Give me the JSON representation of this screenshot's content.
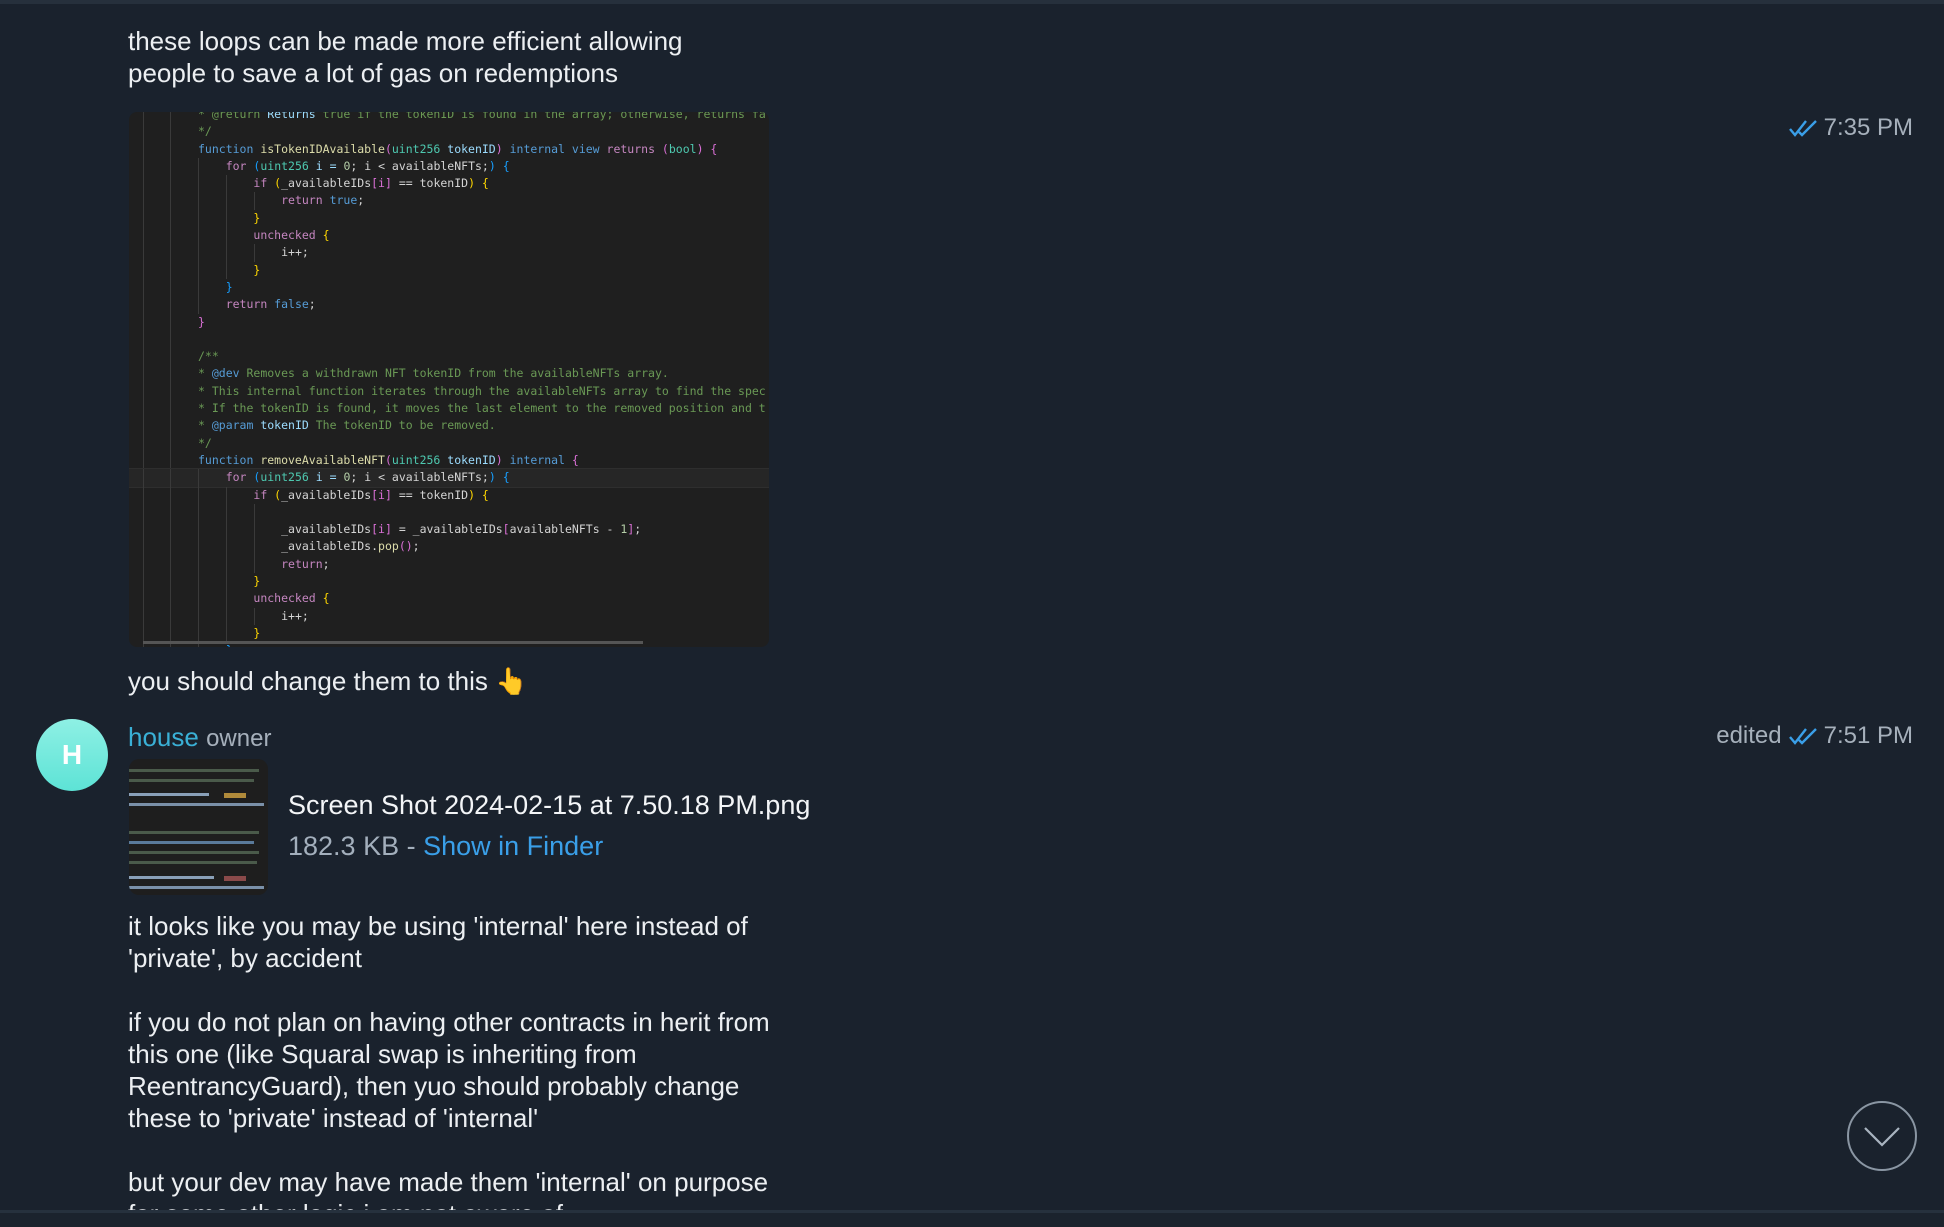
{
  "messages": {
    "msg1_lines": [
      "these loops can be made more efficient allowing",
      "people to save a lot of gas on redemptions"
    ],
    "msg1_time": "7:35 PM",
    "msg2_text": "you should change them to this 👆",
    "sender": {
      "initial": "H",
      "name": "house",
      "role": "owner"
    },
    "msg3_status": "edited",
    "msg3_time": "7:51 PM",
    "file": {
      "name": "Screen Shot 2024-02-15 at 7.50.18 PM.png",
      "size": "182.3 KB",
      "separator": " - ",
      "action": "Show in Finder"
    },
    "msg4_lines": [
      "it looks like you may be using 'internal' here instead of",
      "'private', by accident",
      "",
      "if you do not plan on having other contracts in herit from",
      "this one (like Squaral swap is inheriting from",
      "ReentrancyGuard), then yuo should probably change",
      "these to 'private' instead of 'internal'",
      "",
      "but your dev may have made them 'internal' on purpose",
      "for some other logic i am not aware of"
    ]
  },
  "colors": {
    "accent": "#3a9fe8",
    "sender": "#3ab0d6",
    "avatar": "#6ce8db",
    "background": "#1a222d"
  },
  "icons": {
    "read_check": "double-check-icon",
    "scroll_down": "chevron-down-icon"
  },
  "code_lines": [
    {
      "i": 0,
      "s": [
        [
          "* @return ",
          "cm"
        ],
        [
          "Returns ",
          "va"
        ],
        [
          "true if the tokenID is found in the array; otherwise, returns fa",
          "cm"
        ]
      ]
    },
    {
      "i": 0,
      "s": [
        [
          "*/",
          "cm"
        ]
      ]
    },
    {
      "i": 0,
      "s": [
        [
          "function ",
          "bl"
        ],
        [
          "isTokenIDAvailable",
          "fn"
        ],
        [
          "(",
          "pk"
        ],
        [
          "uint256 ",
          "ty"
        ],
        [
          "tokenID",
          "va"
        ],
        [
          ") ",
          "pk"
        ],
        [
          "internal view ",
          "bl"
        ],
        [
          "returns ",
          "kw"
        ],
        [
          "(",
          "pk"
        ],
        [
          "bool",
          "ty"
        ],
        [
          ") {",
          "pk"
        ]
      ]
    },
    {
      "i": 1,
      "s": [
        [
          "for ",
          "kw"
        ],
        [
          "(",
          "bb"
        ],
        [
          "uint256 ",
          "ty"
        ],
        [
          "i = ",
          "va"
        ],
        [
          "0",
          "nu"
        ],
        [
          "; i < availableNFTs;",
          "tx"
        ],
        [
          ") {",
          "bb"
        ]
      ]
    },
    {
      "i": 2,
      "s": [
        [
          "if ",
          "kw"
        ],
        [
          "(",
          "y"
        ],
        [
          "_availableIDs",
          "tx"
        ],
        [
          "[i]",
          "pk"
        ],
        [
          " == tokenID",
          "tx"
        ],
        [
          ") {",
          "y"
        ]
      ]
    },
    {
      "i": 3,
      "s": [
        [
          "return ",
          "kw"
        ],
        [
          "true",
          "bl"
        ],
        [
          ";",
          "tx"
        ]
      ]
    },
    {
      "i": 2,
      "s": [
        [
          "}",
          "y"
        ]
      ]
    },
    {
      "i": 2,
      "s": [
        [
          "unchecked ",
          "kw"
        ],
        [
          "{",
          "y"
        ]
      ]
    },
    {
      "i": 3,
      "s": [
        [
          "i++;",
          "tx"
        ]
      ]
    },
    {
      "i": 2,
      "s": [
        [
          "}",
          "y"
        ]
      ]
    },
    {
      "i": 1,
      "s": [
        [
          "}",
          "bb"
        ]
      ]
    },
    {
      "i": 1,
      "s": [
        [
          "return ",
          "kw"
        ],
        [
          "false",
          "bl"
        ],
        [
          ";",
          "tx"
        ]
      ]
    },
    {
      "i": 0,
      "s": [
        [
          "}",
          "pk"
        ]
      ]
    },
    {
      "i": 0,
      "s": []
    },
    {
      "i": 0,
      "s": [
        [
          "/**",
          "cm"
        ]
      ]
    },
    {
      "i": 0,
      "s": [
        [
          "* ",
          "cm"
        ],
        [
          "@dev",
          "bl"
        ],
        [
          " Removes a withdrawn NFT tokenID from the availableNFTs array.",
          "cm"
        ]
      ]
    },
    {
      "i": 0,
      "s": [
        [
          "* This internal function iterates through the availableNFTs array to find the spec",
          "cm"
        ]
      ]
    },
    {
      "i": 0,
      "s": [
        [
          "* If the tokenID is found, it moves the last element to the removed position and t",
          "cm"
        ]
      ]
    },
    {
      "i": 0,
      "s": [
        [
          "* ",
          "cm"
        ],
        [
          "@param ",
          "bl"
        ],
        [
          "tokenID ",
          "va"
        ],
        [
          "The tokenID to be removed.",
          "cm"
        ]
      ]
    },
    {
      "i": 0,
      "s": [
        [
          "*/",
          "cm"
        ]
      ]
    },
    {
      "i": 0,
      "s": [
        [
          "function ",
          "bl"
        ],
        [
          "removeAvailableNFT",
          "fn"
        ],
        [
          "(",
          "pk"
        ],
        [
          "uint256 ",
          "ty"
        ],
        [
          "tokenID",
          "va"
        ],
        [
          ") ",
          "pk"
        ],
        [
          "internal ",
          "bl"
        ],
        [
          "{",
          "pk"
        ]
      ]
    },
    {
      "i": 1,
      "h": true,
      "s": [
        [
          "for ",
          "kw"
        ],
        [
          "(",
          "bb"
        ],
        [
          "uint256 ",
          "ty"
        ],
        [
          "i = ",
          "va"
        ],
        [
          "0",
          "nu"
        ],
        [
          "; i < availableNFTs;",
          "tx"
        ],
        [
          ") {",
          "bb"
        ]
      ]
    },
    {
      "i": 2,
      "s": [
        [
          "if ",
          "kw"
        ],
        [
          "(",
          "y"
        ],
        [
          "_availableIDs",
          "tx"
        ],
        [
          "[i]",
          "pk"
        ],
        [
          " == tokenID",
          "tx"
        ],
        [
          ") {",
          "y"
        ]
      ]
    },
    {
      "i": 3,
      "s": []
    },
    {
      "i": 3,
      "s": [
        [
          "_availableIDs",
          "tx"
        ],
        [
          "[i]",
          "pk"
        ],
        [
          " = _availableIDs",
          "tx"
        ],
        [
          "[",
          "pk"
        ],
        [
          "availableNFTs - ",
          "tx"
        ],
        [
          "1",
          "nu"
        ],
        [
          "]",
          "pk"
        ],
        [
          ";",
          "tx"
        ]
      ]
    },
    {
      "i": 3,
      "s": [
        [
          "_availableIDs.",
          "tx"
        ],
        [
          "pop",
          "fn"
        ],
        [
          "()",
          "pk"
        ],
        [
          ";",
          "tx"
        ]
      ]
    },
    {
      "i": 3,
      "s": [
        [
          "return",
          "kw"
        ],
        [
          ";",
          "tx"
        ]
      ]
    },
    {
      "i": 2,
      "s": [
        [
          "}",
          "y"
        ]
      ]
    },
    {
      "i": 2,
      "s": [
        [
          "unchecked ",
          "kw"
        ],
        [
          "{",
          "y"
        ]
      ]
    },
    {
      "i": 3,
      "s": [
        [
          "i++;",
          "tx"
        ]
      ]
    },
    {
      "i": 2,
      "s": [
        [
          "}",
          "y"
        ]
      ]
    },
    {
      "i": 1,
      "s": [
        [
          "}",
          "bb"
        ]
      ]
    }
  ]
}
